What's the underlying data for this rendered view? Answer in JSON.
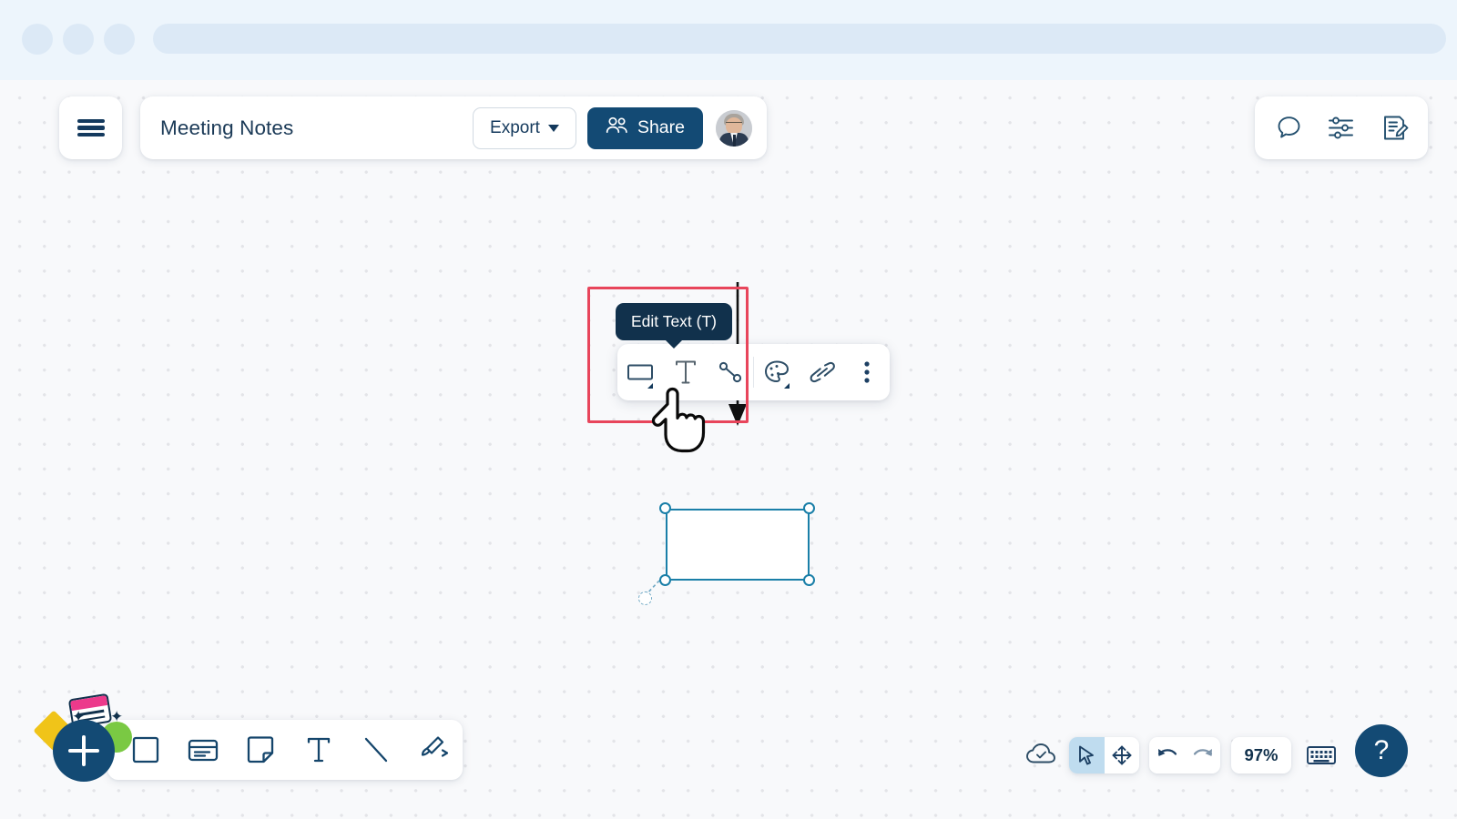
{
  "browser_chrome": {
    "dots": [
      "chrome-dot-1",
      "chrome-dot-2",
      "chrome-dot-3"
    ],
    "address_bar": ""
  },
  "header": {
    "menu_icon": "hamburger-menu-icon",
    "doc_title": "Meeting Notes",
    "export_label": "Export",
    "export_caret": "chevron-down-icon",
    "share_label": "Share",
    "share_icon": "people-icon",
    "avatar": "user-avatar",
    "accent_color": "#134a74"
  },
  "right_tools": [
    {
      "name": "comment-icon",
      "label": "Comments"
    },
    {
      "name": "sliders-icon",
      "label": "Settings"
    },
    {
      "name": "edit-document-icon",
      "label": "Edit Document"
    }
  ],
  "tooltip": {
    "text": "Edit Text (T)",
    "bg_color": "#11314c"
  },
  "highlight": {
    "color": "#e8455b"
  },
  "context_toolbar": [
    {
      "name": "shape-icon",
      "label": "Shape",
      "has_caret": true
    },
    {
      "name": "text-icon",
      "label": "Edit Text",
      "has_caret": false
    },
    {
      "name": "connector-icon",
      "label": "Connector",
      "has_caret": false
    },
    {
      "name": "palette-icon",
      "label": "Color",
      "has_caret": true
    },
    {
      "name": "link-icon",
      "label": "Link",
      "has_caret": false
    },
    {
      "name": "more-options-icon",
      "label": "More",
      "has_caret": false
    }
  ],
  "canvas": {
    "cursor": "pointing-hand-cursor",
    "connector_color": "#111111",
    "shape": {
      "name": "selected-rectangle",
      "text": "",
      "border_color": "#1a7fa8",
      "fill_color": "#ffffff",
      "handles": [
        "top-left",
        "top-right",
        "bottom-left",
        "bottom-right"
      ],
      "rotate_handle": "rotate-handle"
    }
  },
  "bottom_toolbar": {
    "add_label": "+",
    "items": [
      {
        "name": "square-tool-icon",
        "label": "Square"
      },
      {
        "name": "card-tool-icon",
        "label": "Card"
      },
      {
        "name": "sticky-note-tool-icon",
        "label": "Sticky Note"
      },
      {
        "name": "text-tool-icon",
        "label": "Text"
      },
      {
        "name": "line-tool-icon",
        "label": "Line"
      },
      {
        "name": "pen-tool-icon",
        "label": "Draw"
      }
    ]
  },
  "bottom_right": {
    "cloud_icon": "cloud-saved-icon",
    "cursor_icon": "cursor-select-icon",
    "pan_icon": "pan-move-icon",
    "undo_icon": "undo-icon",
    "redo_icon": "redo-icon",
    "zoom_level": "97%",
    "keyboard_icon": "keyboard-shortcuts-icon",
    "help_label": "?"
  }
}
